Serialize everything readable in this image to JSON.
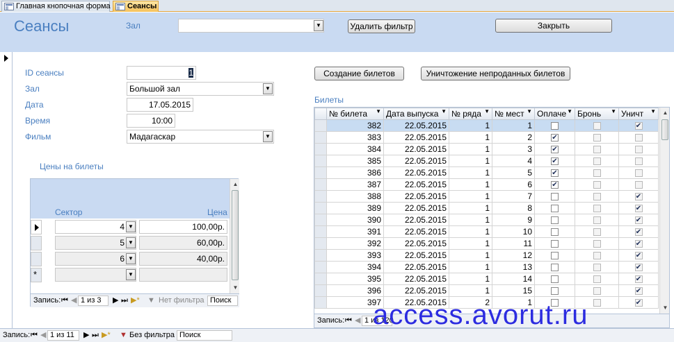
{
  "tabs": [
    {
      "label": "Главная кнопочная форма"
    },
    {
      "label": "Сеансы"
    }
  ],
  "header": {
    "title": "Сеансы",
    "hall_filter_label": "Зал",
    "hall_filter_value": "",
    "remove_filter_label": "Удалить фильтр",
    "close_label": "Закрыть"
  },
  "form": {
    "id_label": "ID сеансы",
    "id_value": "1",
    "hall_label": "Зал",
    "hall_value": "Большой зал",
    "date_label": "Дата",
    "date_value": "17.05.2015",
    "time_label": "Время",
    "time_value": "10:00",
    "film_label": "Фильм",
    "film_value": "Мадагаскар"
  },
  "buttons": {
    "create_tickets": "Создание билетов",
    "destroy_unsold": "Уничтожение непроданных билетов"
  },
  "prices": {
    "title": "Цены на билеты",
    "col_sector": "Сектор",
    "col_price": "Цена",
    "rows": [
      {
        "sector": "4",
        "price": "100,00р."
      },
      {
        "sector": "5",
        "price": "60,00р."
      },
      {
        "sector": "6",
        "price": "40,00р."
      }
    ],
    "nav": {
      "record_label": "Запись:",
      "position": "1 из 3",
      "filter": "Нет фильтра",
      "search": "Поиск"
    }
  },
  "tickets": {
    "title": "Билеты",
    "columns": [
      "№ билета",
      "Дата выпуска",
      "№ ряда",
      "№ мест",
      "Оплаче",
      "Бронь",
      "Уничт"
    ],
    "rows": [
      {
        "id": "382",
        "date": "22.05.2015",
        "row": "1",
        "seat": "1",
        "paid": false,
        "booked": false,
        "destroyed": true
      },
      {
        "id": "383",
        "date": "22.05.2015",
        "row": "1",
        "seat": "2",
        "paid": true,
        "booked": false,
        "destroyed": false
      },
      {
        "id": "384",
        "date": "22.05.2015",
        "row": "1",
        "seat": "3",
        "paid": true,
        "booked": false,
        "destroyed": false
      },
      {
        "id": "385",
        "date": "22.05.2015",
        "row": "1",
        "seat": "4",
        "paid": true,
        "booked": false,
        "destroyed": false
      },
      {
        "id": "386",
        "date": "22.05.2015",
        "row": "1",
        "seat": "5",
        "paid": true,
        "booked": false,
        "destroyed": false
      },
      {
        "id": "387",
        "date": "22.05.2015",
        "row": "1",
        "seat": "6",
        "paid": true,
        "booked": false,
        "destroyed": false
      },
      {
        "id": "388",
        "date": "22.05.2015",
        "row": "1",
        "seat": "7",
        "paid": false,
        "booked": false,
        "destroyed": true
      },
      {
        "id": "389",
        "date": "22.05.2015",
        "row": "1",
        "seat": "8",
        "paid": false,
        "booked": false,
        "destroyed": true
      },
      {
        "id": "390",
        "date": "22.05.2015",
        "row": "1",
        "seat": "9",
        "paid": false,
        "booked": false,
        "destroyed": true
      },
      {
        "id": "391",
        "date": "22.05.2015",
        "row": "1",
        "seat": "10",
        "paid": false,
        "booked": false,
        "destroyed": true
      },
      {
        "id": "392",
        "date": "22.05.2015",
        "row": "1",
        "seat": "11",
        "paid": false,
        "booked": false,
        "destroyed": true
      },
      {
        "id": "393",
        "date": "22.05.2015",
        "row": "1",
        "seat": "12",
        "paid": false,
        "booked": false,
        "destroyed": true
      },
      {
        "id": "394",
        "date": "22.05.2015",
        "row": "1",
        "seat": "13",
        "paid": false,
        "booked": false,
        "destroyed": true
      },
      {
        "id": "395",
        "date": "22.05.2015",
        "row": "1",
        "seat": "14",
        "paid": false,
        "booked": false,
        "destroyed": true
      },
      {
        "id": "396",
        "date": "22.05.2015",
        "row": "1",
        "seat": "15",
        "paid": false,
        "booked": false,
        "destroyed": true
      },
      {
        "id": "397",
        "date": "22.05.2015",
        "row": "2",
        "seat": "1",
        "paid": false,
        "booked": false,
        "destroyed": true
      }
    ],
    "nav": {
      "record_label": "Запись:",
      "position": "1 из 120"
    }
  },
  "main_nav": {
    "record_label": "Запись:",
    "position": "1 из 11",
    "filter": "Без фильтра",
    "search": "Поиск"
  },
  "watermark": "access.avorut.ru"
}
